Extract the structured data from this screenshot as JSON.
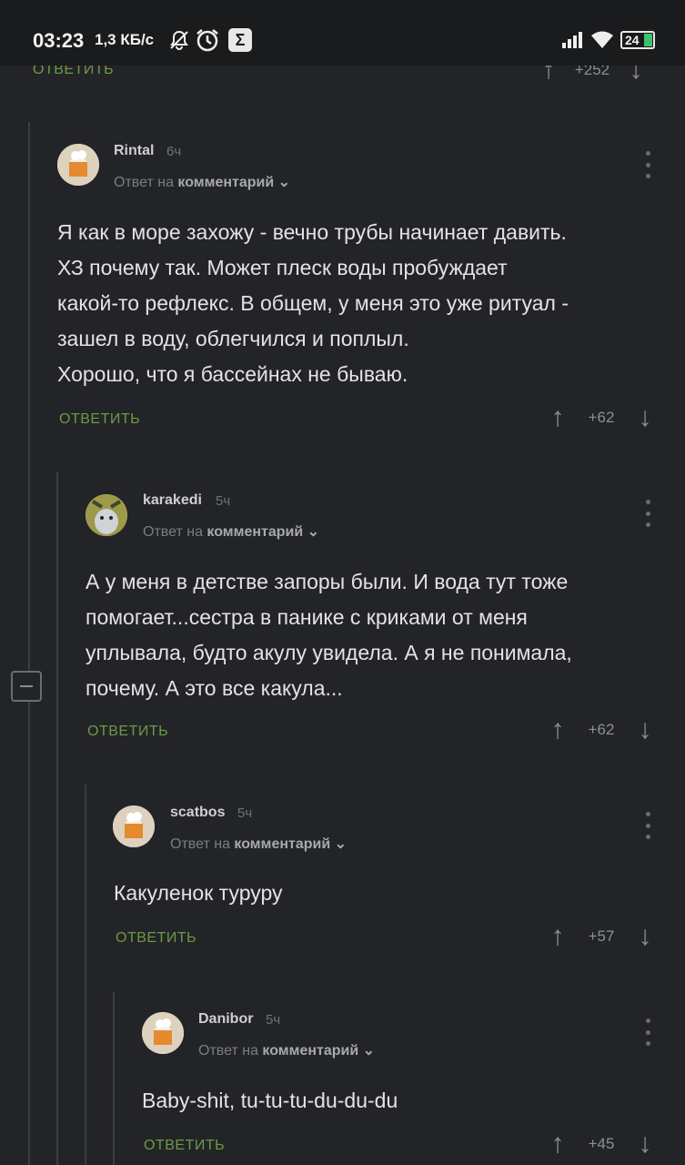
{
  "status_bar": {
    "time": "03:23",
    "net_speed": "1,3 КБ/с",
    "battery": "24",
    "icons": [
      "notifications-off-icon",
      "alarm-icon",
      "sigma-icon",
      "signal-icon",
      "wifi-icon",
      "battery-icon"
    ]
  },
  "top_partial": {
    "reply_label": "ОТВЕТИТЬ",
    "votes": "+252"
  },
  "comments": [
    {
      "author": "Rintal",
      "time": "6ч",
      "reply_prefix": "Ответ на",
      "reply_target": "комментарий",
      "lines": [
        "Я как в море захожу - вечно трубы начинает давить.",
        "ХЗ почему так. Может плеск воды пробуждает",
        "какой-то рефлекс. В общем, у меня это уже ритуал -",
        "зашел в воду, облегчился и поплыл.",
        "Хорошо, что я бассейнах не бываю."
      ],
      "reply_label": "ОТВЕТИТЬ",
      "votes": "+62"
    },
    {
      "author": "karakedi",
      "time": "5ч",
      "reply_prefix": "Ответ на",
      "reply_target": "комментарий",
      "lines": [
        "А у меня в детстве запоры были. И вода тут тоже",
        "помогает...сестра в панике с криками от меня",
        "уплывала, будто акулу увидела. А я не понимала,",
        "почему. А это все какула..."
      ],
      "reply_label": "ОТВЕТИТЬ",
      "votes": "+62"
    },
    {
      "author": "scatbos",
      "time": "5ч",
      "reply_prefix": "Ответ на",
      "reply_target": "комментарий",
      "lines": [
        "Какуленок туруру"
      ],
      "reply_label": "ОТВЕТИТЬ",
      "votes": "+57"
    },
    {
      "author": "Danibor",
      "time": "5ч",
      "reply_prefix": "Ответ на",
      "reply_target": "комментарий",
      "lines": [
        "Baby-shit, tu-tu-tu-du-du-du"
      ],
      "reply_label": "ОТВЕТИТЬ",
      "votes": "+45"
    }
  ]
}
